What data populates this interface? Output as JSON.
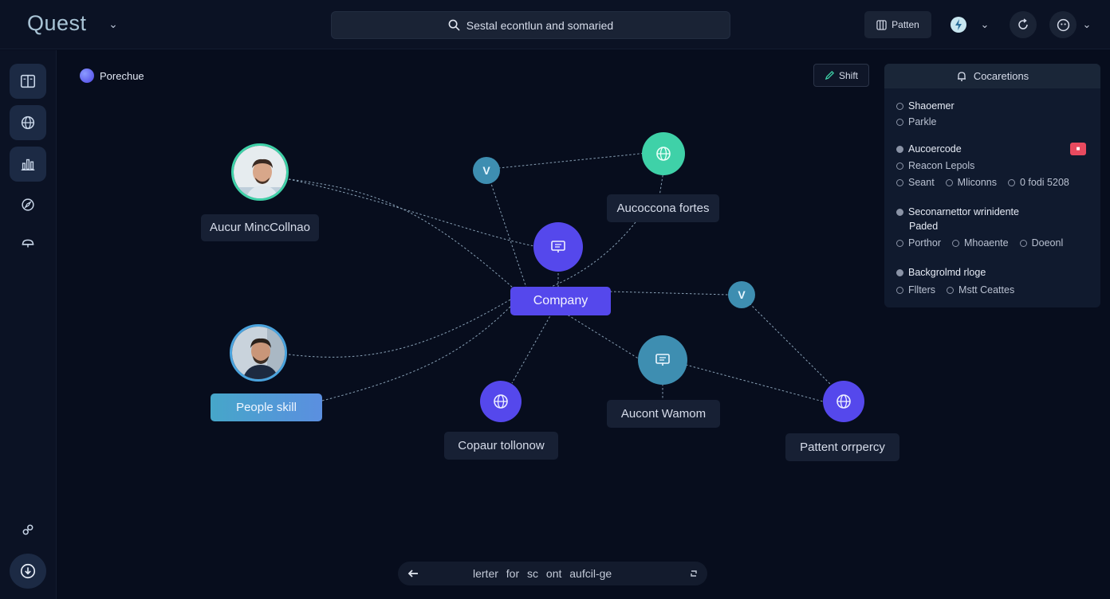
{
  "app": {
    "brand": "Quest",
    "search": "Sestal econtlun and somaried",
    "top_button": "Patten"
  },
  "canvas": {
    "recommendation_label": "Porechue",
    "shift_button": "Shift"
  },
  "graph": {
    "central_label": "Company",
    "labels": {
      "person_top": "Aucur MincCollnao",
      "top_right": "Aucoccona fortes",
      "people": "People skill",
      "bottom_mid": "Copaur tollonow",
      "mid_bottom": "Aucont Wamom",
      "far_right": "Pattent orrpercy"
    },
    "small_node_glyph": "V"
  },
  "panel": {
    "title": "Cocaretions",
    "sections": [
      {
        "title": "Shaoemer",
        "items": [
          "Parkle"
        ]
      },
      {
        "title": "Aucoercode",
        "badge": "■",
        "sub": "Reacon Lepols",
        "items": [
          "Seant",
          "Mliconns",
          "0 fodi 5208"
        ]
      },
      {
        "title": "Seconarnettor wrinidente",
        "sub": "Paded",
        "items": [
          "Porthor",
          "Mhoaente",
          "Doeonl"
        ]
      },
      {
        "title": "Backgrolmd rloge",
        "items": [
          "Fllters",
          "Mstt Ceattes"
        ]
      }
    ]
  },
  "bottom_bar": {
    "text": "lerter for sc ont aufcil-ge"
  },
  "colors": {
    "background": "#070d1d",
    "accent_violet": "#5548ec",
    "accent_teal": "#3fd1a8",
    "accent_blue": "#3e8eb1",
    "badge_red": "#e84a5f"
  }
}
